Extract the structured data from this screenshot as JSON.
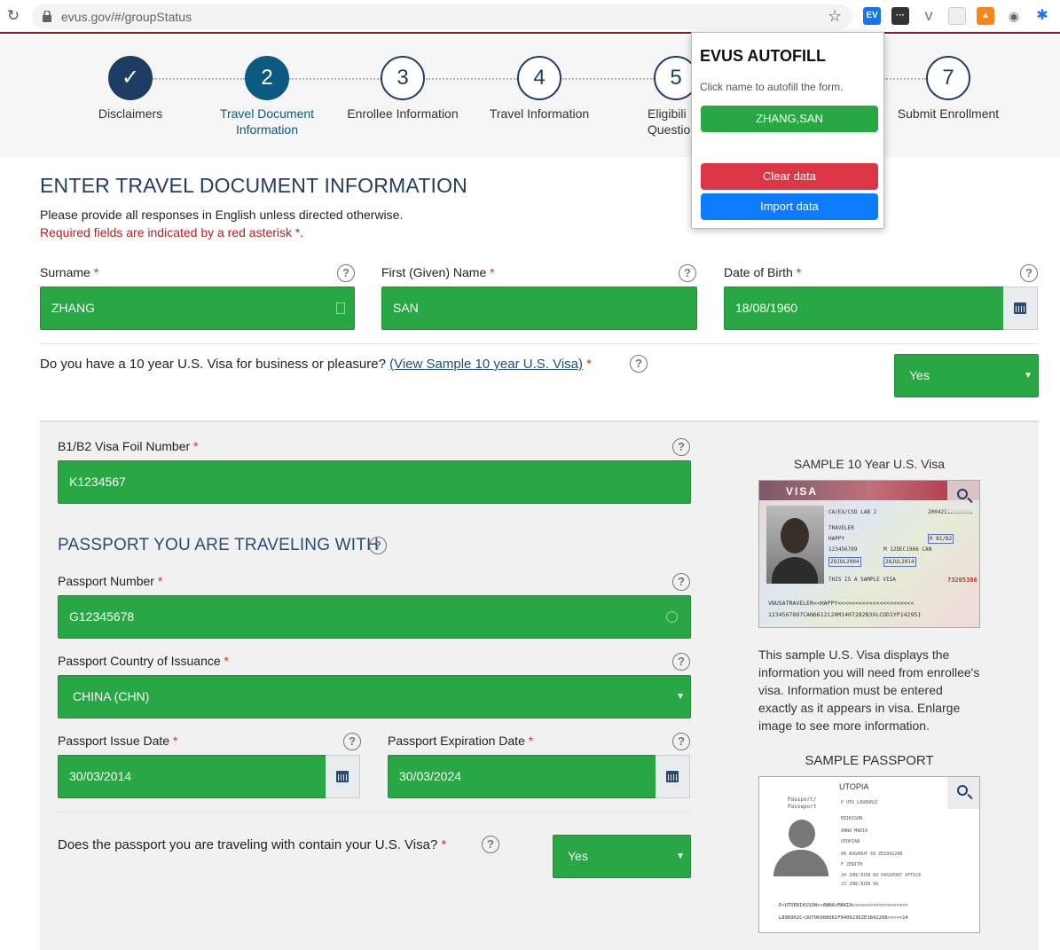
{
  "browser": {
    "url": "evus.gov/#/groupStatus"
  },
  "steps": [
    {
      "num": "✓",
      "label": "Disclaimers"
    },
    {
      "num": "2",
      "label": "Travel Document Information"
    },
    {
      "num": "3",
      "label": "Enrollee Information"
    },
    {
      "num": "4",
      "label": "Travel Information"
    },
    {
      "num": "5",
      "label": "Eligibili Questio"
    },
    {
      "num": "7",
      "label": "Submit Enrollment"
    }
  ],
  "popup": {
    "title": "EVUS AUTOFILL",
    "hint": "Click name to autofill the form.",
    "name_button": "ZHANG,SAN",
    "clear_button": "Clear data",
    "import_button": "Import data"
  },
  "page": {
    "heading": "ENTER TRAVEL DOCUMENT INFORMATION",
    "subtext": "Please provide all responses in English unless directed otherwise.",
    "required_note": "Required fields are indicated by a red asterisk *."
  },
  "fields": {
    "surname_label": "Surname",
    "surname_value": "ZHANG",
    "given_label": "First (Given) Name",
    "given_value": "SAN",
    "dob_label": "Date of Birth",
    "dob_value": "18/08/1960",
    "visa_question": "Do you have a 10 year U.S. Visa for business or pleasure?",
    "visa_link": "(View Sample 10 year U.S. Visa)",
    "visa_answer": "Yes",
    "foil_label": "B1/B2 Visa Foil Number",
    "foil_value": "K1234567",
    "passport_section": "PASSPORT YOU ARE TRAVELING WITH",
    "passport_num_label": "Passport Number",
    "passport_num_value": "G12345678",
    "country_label": "Passport Country of Issuance",
    "country_value": "CHINA (CHN)",
    "issue_label": "Passport Issue Date",
    "issue_value": "30/03/2014",
    "expiry_label": "Passport Expiration Date",
    "expiry_value": "30/03/2024",
    "contains_question": "Does the passport you are traveling with contain your U.S. Visa?",
    "contains_answer": "Yes"
  },
  "samples": {
    "visa_title": "SAMPLE 10 Year U.S. Visa",
    "visa_desc": "This sample U.S. Visa displays the information you will need from enrollee's visa. Information must be entered exactly as it appears in visa. Enlarge image to see more information.",
    "passport_title": "SAMPLE PASSPORT",
    "visa_word": "VISA",
    "visa_mrz1": "VNUSATRAVELER<<HAPPY<<<<<<<<<<<<<<<<<<<<<<",
    "visa_mrz2": "1234567897CAN6612120M1407282B3XLCOD1YP142951",
    "visa_sample_text": "THIS IS A SAMPLE VISA",
    "visa_red_number": "73205386",
    "passport_country": "UTOPIA",
    "passport_mrz1": "P<UTOERIKSSON<<ANNA<MARIA<<<<<<<<<<<<<<<<<<<",
    "passport_mrz2": "L898902C<3UTO6908061F9406236ZE184226B<<<<<14"
  },
  "colors": {
    "green": "#29a745",
    "navy": "#1f3d63",
    "red_button": "#dc3545",
    "blue_button": "#0d7bff"
  }
}
